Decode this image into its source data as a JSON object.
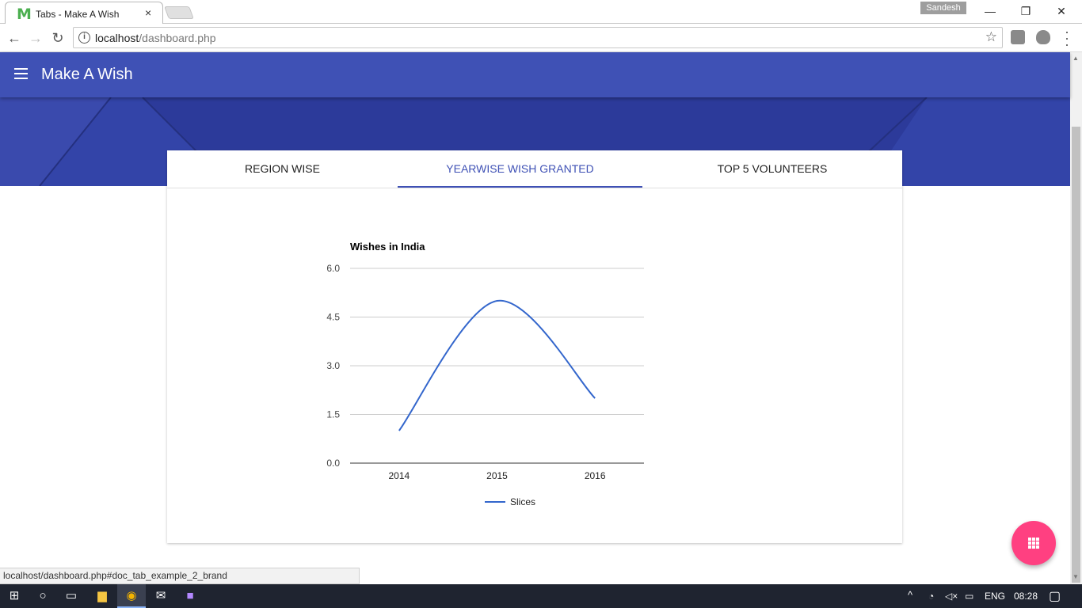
{
  "browser": {
    "tab_title": "Tabs - Make A Wish",
    "tab_favicon": "M",
    "tab_close": "×",
    "user_name": "Sandesh",
    "window_minimize": "—",
    "window_restore": "❐",
    "window_close": "✕",
    "url_host": "localhost",
    "url_path": "/dashboard.php",
    "status_link": "localhost/dashboard.php#doc_tab_example_2_brand"
  },
  "app": {
    "title": "Make A Wish",
    "tabs": [
      {
        "label": "REGION WISE"
      },
      {
        "label": "YEARWISE WISH GRANTED"
      },
      {
        "label": "TOP 5 VOLUNTEERS"
      }
    ],
    "active_tab": 1,
    "colors": {
      "primary": "#3f51b5",
      "accent": "#ff4081",
      "line": "#3366cc"
    }
  },
  "chart_data": {
    "type": "line",
    "title": "Wishes in India",
    "categories": [
      "2014",
      "2015",
      "2016"
    ],
    "series": [
      {
        "name": "Slices",
        "values": [
          1,
          5,
          2
        ]
      }
    ],
    "ylim": [
      0,
      6
    ],
    "yticks": [
      "0.0",
      "1.5",
      "3.0",
      "4.5",
      "6.0"
    ],
    "smooth": true,
    "grid": true,
    "legend": "bottom"
  },
  "taskbar": {
    "language": "ENG",
    "time": "08:28"
  }
}
